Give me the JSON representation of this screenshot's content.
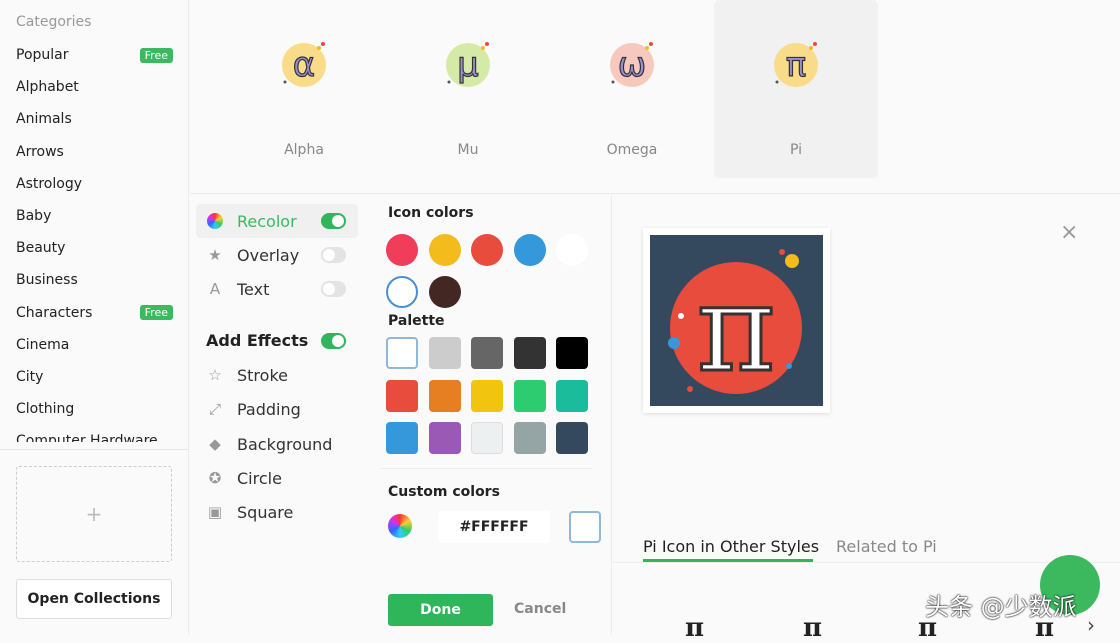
{
  "sidebar": {
    "title": "Categories",
    "items": [
      {
        "label": "Popular",
        "badge": "Free"
      },
      {
        "label": "Alphabet"
      },
      {
        "label": "Animals"
      },
      {
        "label": "Arrows"
      },
      {
        "label": "Astrology"
      },
      {
        "label": "Baby"
      },
      {
        "label": "Beauty"
      },
      {
        "label": "Business"
      },
      {
        "label": "Characters",
        "badge": "Free"
      },
      {
        "label": "Cinema"
      },
      {
        "label": "City"
      },
      {
        "label": "Clothing"
      },
      {
        "label": "Computer Hardware"
      }
    ],
    "dropzone_icon": "+",
    "open_collections": "Open Collections"
  },
  "icons": [
    {
      "label": "Alpha",
      "glyph": "α",
      "bg": "#f9dc8a"
    },
    {
      "label": "Mu",
      "glyph": "μ",
      "bg": "#d6eaa8"
    },
    {
      "label": "Omega",
      "glyph": "ω",
      "bg": "#f7c9be"
    },
    {
      "label": "Pi",
      "glyph": "π",
      "bg": "#f9dc8a",
      "selected": true
    }
  ],
  "menu": {
    "recolor": "Recolor",
    "overlay": "Overlay",
    "text": "Text",
    "add_effects": "Add Effects",
    "stroke": "Stroke",
    "padding": "Padding",
    "background": "Background",
    "circle": "Circle",
    "square": "Square"
  },
  "colors": {
    "icon_colors_title": "Icon colors",
    "icon_colors": [
      "#ef3d5a",
      "#f3bb1b",
      "#e84c3d",
      "#3498db",
      "#ffffff",
      "#ffffff",
      "#432722"
    ],
    "palette_title": "Palette",
    "palette": [
      "#ffffff",
      "#cccccc",
      "#666666",
      "#333333",
      "#000000",
      "#e84c3d",
      "#e67e22",
      "#f1c40f",
      "#2ecc71",
      "#1abc9c",
      "#3498db",
      "#9b59b6",
      "#ecf0f1",
      "#95a5a6",
      "#34495e"
    ],
    "custom_title": "Custom colors",
    "hex_value": "#FFFFFF",
    "done": "Done",
    "cancel": "Cancel",
    "accent": "#2fb55a"
  },
  "preview": {
    "glyph": "π",
    "bg": "#34495e",
    "circle": "#e84c3d",
    "close_icon": "×"
  },
  "tabs": {
    "active": "Pi Icon in Other Styles",
    "other": "Related to Pi"
  },
  "other_styles": [
    "π",
    "π",
    "π",
    "π"
  ],
  "watermark": "头条 @少数派"
}
